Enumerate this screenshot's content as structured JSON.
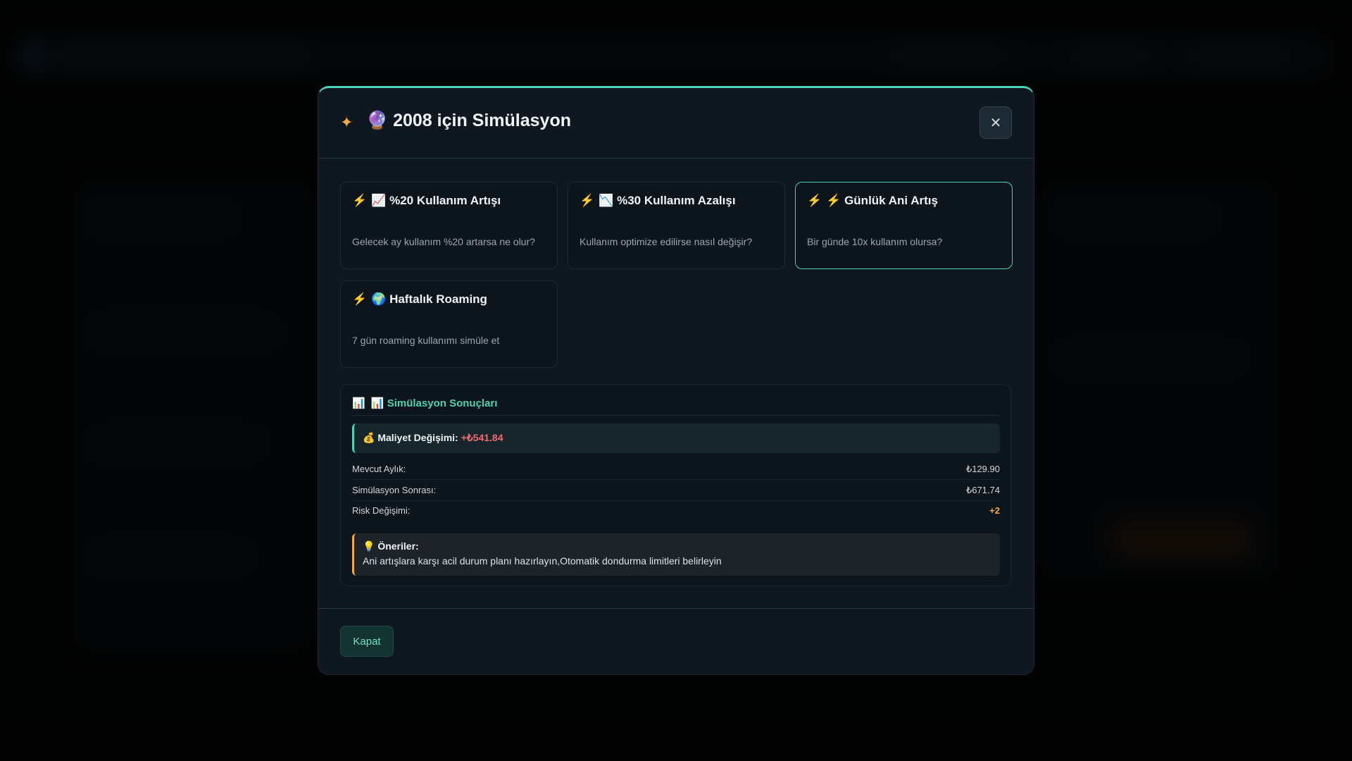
{
  "modal": {
    "sparkle_icon": "✦",
    "title_icon": "🔮",
    "title": "2008 için Simülasyon",
    "close_icon": "✕"
  },
  "scenarios": [
    {
      "bolt": "⚡",
      "icon": "📈",
      "title": "%20 Kullanım Artışı",
      "description": "Gelecek ay kullanım %20 artarsa ne olur?",
      "selected": false
    },
    {
      "bolt": "⚡",
      "icon": "📉",
      "title": "%30 Kullanım Azalışı",
      "description": "Kullanım optimize edilirse nasıl değişir?",
      "selected": false
    },
    {
      "bolt": "⚡",
      "icon": "⚡",
      "title": "Günlük Ani Artış",
      "description": "Bir günde 10x kullanım olursa?",
      "selected": true
    },
    {
      "bolt": "⚡",
      "icon": "🌍",
      "title": "Haftalık Roaming",
      "description": "7 gün roaming kullanımı simüle et",
      "selected": false
    }
  ],
  "results": {
    "icon1": "📊",
    "icon2": "📊",
    "title": "Simülasyon Sonuçları",
    "cost_icon": "💰",
    "cost_label": "Maliyet Değişimi:",
    "cost_value": "+₺541.84",
    "rows": [
      {
        "label": "Mevcut Aylık:",
        "value": "₺129.90"
      },
      {
        "label": "Simülasyon Sonrası:",
        "value": "₺671.74"
      },
      {
        "label": "Risk Değişimi:",
        "value": "+2"
      }
    ],
    "recommendations_icon": "💡",
    "recommendations_title": "Öneriler:",
    "recommendations_text": "Ani artışlara karşı acil durum planı hazırlayın,Otomatik dondurma limitleri belirleyin"
  },
  "footer": {
    "close_label": "Kapat"
  },
  "colors": {
    "accent": "#4fd1b5",
    "warning": "#f4a942",
    "negative": "#f06b6b"
  }
}
